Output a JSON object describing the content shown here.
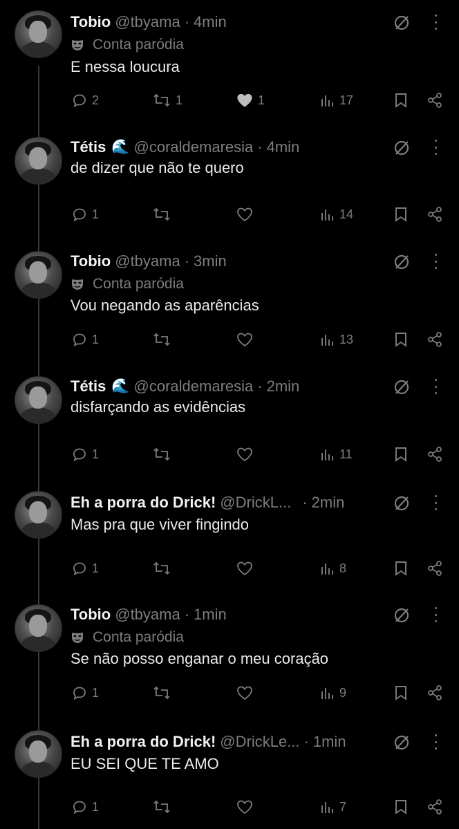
{
  "posts": [
    {
      "name_prefix": "Tobio",
      "name_bold": "",
      "name_suffix": "",
      "emoji": "",
      "handle": "@tbyama",
      "time": "4min",
      "parody": "Conta paródia",
      "text": "E nessa loucura",
      "replies": "2",
      "reposts": "1",
      "likes": "1",
      "views": "17",
      "liked": true
    },
    {
      "name_prefix": "Tétis",
      "name_bold": "",
      "name_suffix": "",
      "emoji": "🌊",
      "handle": "@coraldemaresia",
      "time": "4min",
      "parody": "",
      "text": "de dizer que não te quero",
      "replies": "1",
      "reposts": "",
      "likes": "",
      "views": "14",
      "liked": false
    },
    {
      "name_prefix": "Tobio",
      "name_bold": "",
      "name_suffix": "",
      "emoji": "",
      "handle": "@tbyama",
      "time": "3min",
      "parody": "Conta paródia",
      "text": "Vou negando as aparências",
      "replies": "1",
      "reposts": "",
      "likes": "",
      "views": "13",
      "liked": false
    },
    {
      "name_prefix": "Tétis",
      "name_bold": "",
      "name_suffix": "",
      "emoji": "🌊",
      "handle": "@coraldemaresia",
      "time": "2min",
      "parody": "",
      "text": "disfarçando as evidências",
      "replies": "1",
      "reposts": "",
      "likes": "",
      "views": "11",
      "liked": false
    },
    {
      "name_prefix": "Eh a ",
      "name_bold": "porra",
      "name_suffix": " do Drick!",
      "emoji": "",
      "handle": "@DrickL...",
      "time": "2min",
      "parody": "",
      "text": "Mas pra que viver fingindo",
      "replies": "1",
      "reposts": "",
      "likes": "",
      "views": "8",
      "liked": false
    },
    {
      "name_prefix": "Tobio",
      "name_bold": "",
      "name_suffix": "",
      "emoji": "",
      "handle": "@tbyama",
      "time": "1min",
      "parody": "Conta paródia",
      "text": "Se não posso enganar o meu coração",
      "replies": "1",
      "reposts": "",
      "likes": "",
      "views": "9",
      "liked": false
    },
    {
      "name_prefix": "Eh a ",
      "name_bold": "porra",
      "name_suffix": " do Drick!",
      "emoji": "",
      "handle": "@DrickLe...",
      "time": "1min",
      "parody": "",
      "text": "EU SEI QUE TE AMO",
      "replies": "1",
      "reposts": "",
      "likes": "",
      "views": "7",
      "liked": false
    }
  ],
  "colors": {
    "background": "#000000",
    "text": "#e7e9ea",
    "muted": "#7d7d7d"
  },
  "icons": [
    "reply-icon",
    "repost-icon",
    "heart-icon",
    "views-icon",
    "bookmark-icon",
    "share-icon",
    "grok-icon",
    "more-icon",
    "parody-mask-icon"
  ]
}
